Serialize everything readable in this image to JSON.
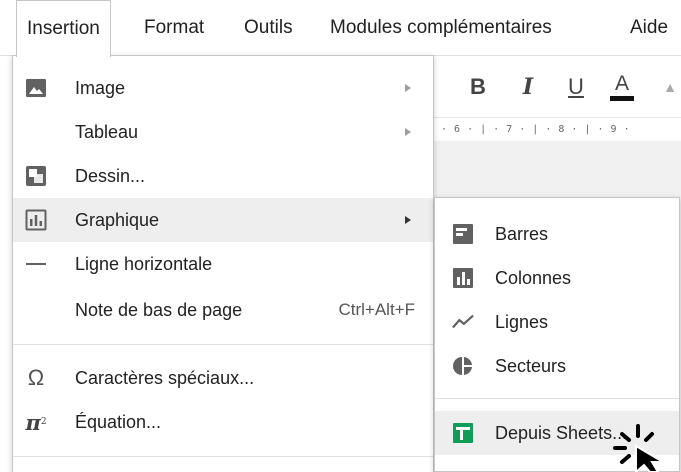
{
  "menubar": {
    "items": [
      {
        "label": "Insertion",
        "active": true
      },
      {
        "label": "Format"
      },
      {
        "label": "Outils"
      },
      {
        "label": "Modules complémentaires"
      },
      {
        "label": "Aide"
      }
    ]
  },
  "toolbar": {
    "bold": "B",
    "italic": "I",
    "underline": "U",
    "text_color": "A",
    "ruler": "· 6 · | · 7 · | · 8 · | · 9 ·"
  },
  "insert_menu": {
    "items": [
      {
        "label": "Image",
        "icon": "image-icon",
        "submenu": true
      },
      {
        "label": "Tableau",
        "submenu": true
      },
      {
        "label": "Dessin..."
      },
      {
        "label": "Graphique",
        "icon": "chart-icon",
        "submenu": true,
        "highlighted": true
      },
      {
        "label": "Ligne horizontale",
        "icon": "horizontal-line-icon"
      },
      {
        "label": "Note de bas de page",
        "shortcut": "Ctrl+Alt+F"
      },
      {
        "label": "Caractères spéciaux...",
        "icon": "omega-icon",
        "glyph": "Ω"
      },
      {
        "label": "Équation...",
        "icon": "pi-icon",
        "glyph": "π"
      }
    ]
  },
  "chart_submenu": {
    "items": [
      {
        "label": "Barres",
        "icon": "bar-chart-icon"
      },
      {
        "label": "Colonnes",
        "icon": "column-chart-icon"
      },
      {
        "label": "Lignes",
        "icon": "line-chart-icon"
      },
      {
        "label": "Secteurs",
        "icon": "pie-chart-icon"
      },
      {
        "label": "Depuis Sheets...",
        "icon": "sheets-icon",
        "highlighted": true
      }
    ]
  },
  "colors": {
    "menu_hover": "#eeeeee",
    "sheets_green": "#0f9d58",
    "icon_gray": "#616161"
  }
}
